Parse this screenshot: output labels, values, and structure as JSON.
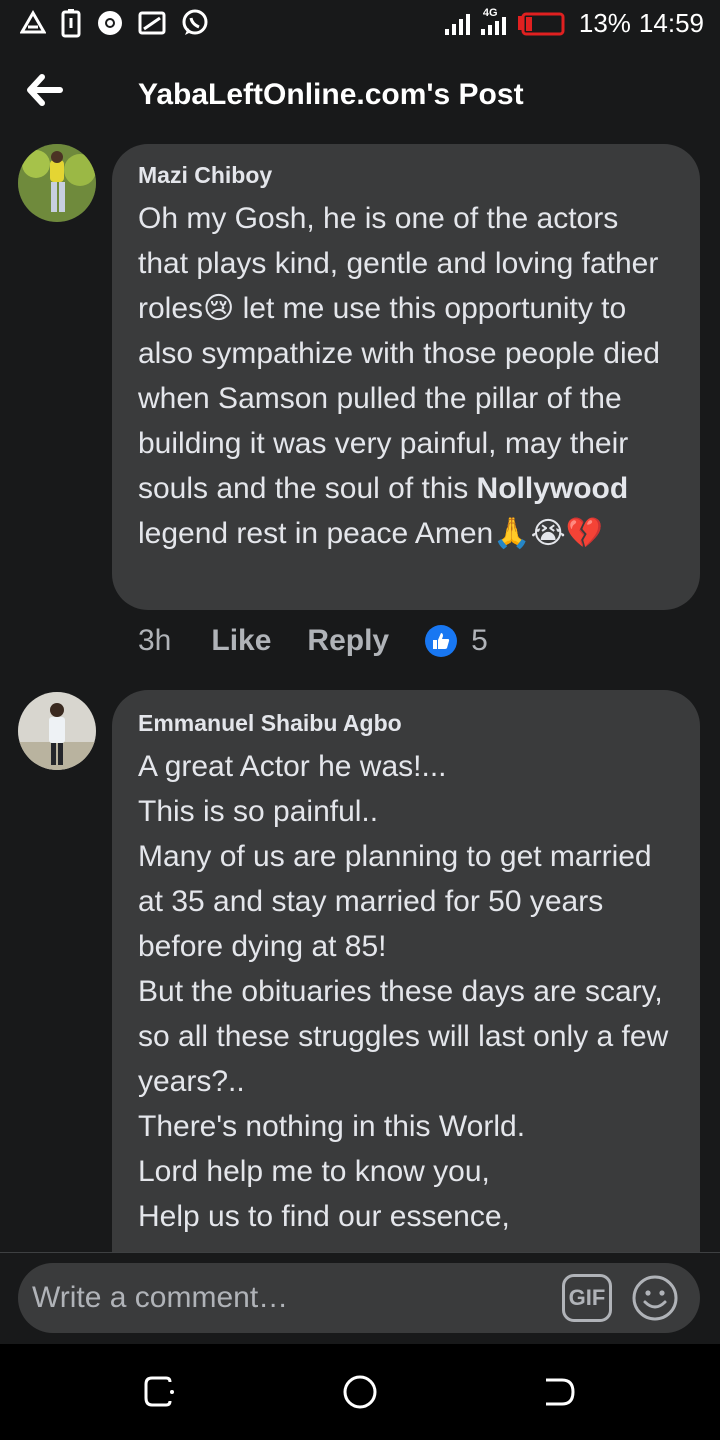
{
  "status_bar": {
    "network_type": "4G",
    "battery_percent": "13%",
    "time": "14:59",
    "left_icons": [
      "warning-triangle-icon",
      "battery-saver-icon",
      "chrome-icon",
      "cast-icon",
      "whatsapp-icon"
    ],
    "battery_color": "#e02020"
  },
  "header": {
    "back_icon": "back-arrow-icon",
    "title": "YabaLeftOnline.com's Post"
  },
  "comments": [
    {
      "author": "Mazi Chiboy",
      "text_before_bold": "Oh my Gosh, he is one of the actors that plays kind, gentle and loving father roles😢 let me use this opportunity to also sympathize with those people died when Samson pulled the pillar of the building it was very painful, may their souls and the soul of this ",
      "text_bold": "Nollywood",
      "text_after_bold": " legend rest in peace Amen🙏😭💔",
      "time": "3h",
      "like_label": "Like",
      "reply_label": "Reply",
      "reaction_icon": "thumbs-up-icon",
      "reaction_count": "5"
    },
    {
      "author": "Emmanuel Shaibu Agbo",
      "text": "A great Actor he was!...\nThis is so painful..\nMany of us are planning to get married at 35 and stay married for 50 years before dying at 85!\nBut the obituaries these days are scary, so all these struggles will last only a few years?..\nThere's nothing in this World.\nLord help me to know you,\nHelp us to find our essence,"
    }
  ],
  "composer": {
    "placeholder": "Write a comment…",
    "gif_label": "GIF",
    "emoji_icon": "smiley-icon"
  },
  "nav_bar": {
    "icons": [
      "recent-apps-icon",
      "home-icon",
      "back-icon"
    ]
  },
  "colors": {
    "background": "#18191a",
    "bubble": "#3a3b3c",
    "text": "#e4e6eb",
    "secondary_text": "#b0b3b8",
    "like_blue": "#1877f2"
  }
}
